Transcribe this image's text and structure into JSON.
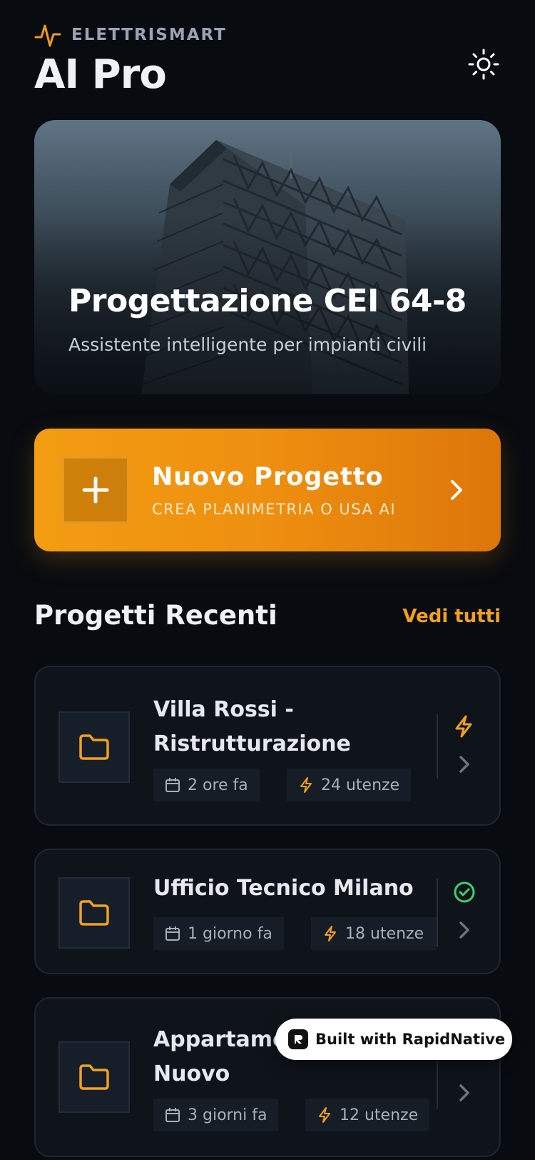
{
  "header": {
    "brand": "ELETTRISMART",
    "title": "AI Pro",
    "brand_icon": "pulse-icon",
    "theme_icon": "sun-icon"
  },
  "hero": {
    "title": "Progettazione CEI 64-8",
    "subtitle": "Assistente intelligente per impianti civili"
  },
  "new_project": {
    "title": "Nuovo Progetto",
    "subtitle": "CREA PLANIMETRIA O USA AI"
  },
  "recent": {
    "title": "Progetti Recenti",
    "see_all": "Vedi tutti",
    "projects": [
      {
        "name_line1": "Villa Rossi -",
        "name_line2": "Ristrutturazione",
        "time": "2 ore fa",
        "loads": "24 utenze",
        "status_icon": "bolt-icon"
      },
      {
        "name_line1": "Ufficio Tecnico Milano",
        "name_line2": "",
        "time": "1 giorno fa",
        "loads": "18 utenze",
        "status_icon": "check-circle-icon"
      },
      {
        "name_line1": "Appartame",
        "name_line2": "Nuovo",
        "time": "3 giorni fa",
        "loads": "12 utenze",
        "status_icon": "partially-hidden-icon"
      }
    ]
  },
  "badge": {
    "label": "Built with RapidNative"
  },
  "colors": {
    "accent": "#f29d12",
    "background": "#080b10",
    "card": "#0f141b",
    "success": "#3ecf6a"
  }
}
